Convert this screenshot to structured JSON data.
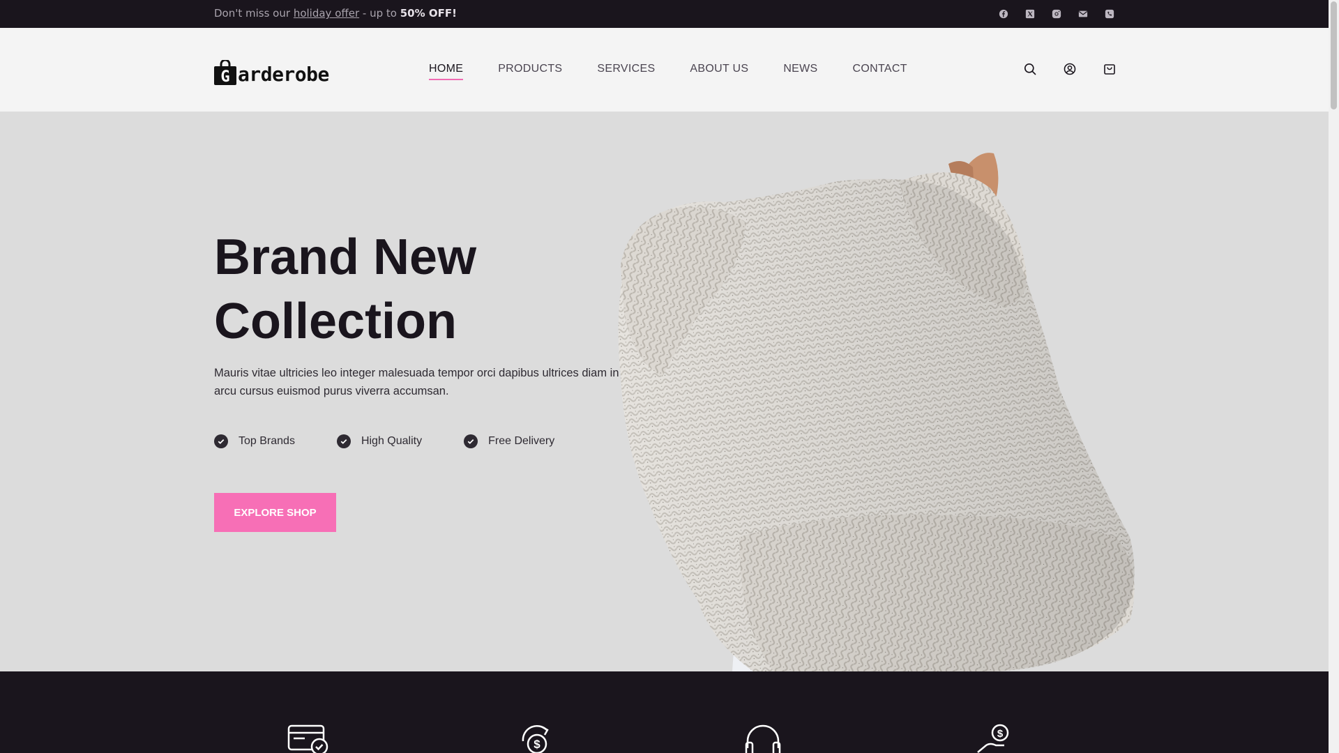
{
  "topbar": {
    "promo_prefix": "Don't miss our",
    "promo_link": "holiday offer",
    "promo_middle": "- up to",
    "promo_bold": "50% OFF!",
    "social_icons": [
      "facebook-icon",
      "x-twitter-icon",
      "instagram-icon",
      "email-icon",
      "phone-icon"
    ]
  },
  "header": {
    "logo_letter": "G",
    "logo_text": "arderobe",
    "nav": [
      {
        "label": "HOME",
        "active": true
      },
      {
        "label": "PRODUCTS",
        "active": false
      },
      {
        "label": "SERVICES",
        "active": false
      },
      {
        "label": "ABOUT US",
        "active": false
      },
      {
        "label": "NEWS",
        "active": false
      },
      {
        "label": "CONTACT",
        "active": false
      }
    ],
    "icons": [
      "search-icon",
      "user-account-icon",
      "shopping-bag-icon"
    ]
  },
  "hero": {
    "title_line1": "Brand New",
    "title_line2": "Collection",
    "description": "Mauris vitae ultricies leo integer malesuada tempor orci dapibus ultrices diam in arcu cursus euismod purus viverra accumsan.",
    "features": [
      "Top Brands",
      "High Quality",
      "Free Delivery"
    ],
    "cta_label": "EXPLORE SHOP"
  },
  "services": {
    "icons": [
      "credit-card-check-icon",
      "money-exchange-icon",
      "headphones-support-icon",
      "hand-money-icon"
    ]
  },
  "colors": {
    "accent": "#f76fb6",
    "dark": "#1a151d",
    "hero_bg": "#dcdcdc",
    "header_bg": "#f4f4f4"
  }
}
